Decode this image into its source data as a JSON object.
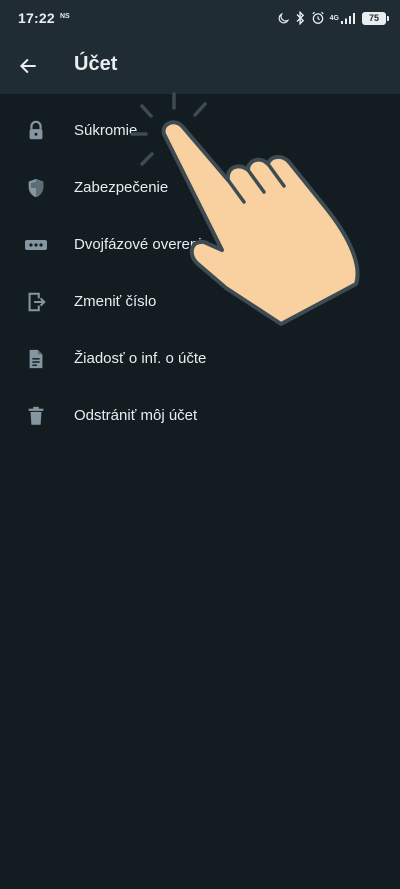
{
  "status_bar": {
    "time": "17:22",
    "ns_label": "NS",
    "network": "4G",
    "battery": "75",
    "icons": [
      "moon-icon",
      "bluetooth-icon",
      "alarm-icon",
      "signal-icon",
      "battery-icon"
    ]
  },
  "app_bar": {
    "back_icon": "arrow-left-icon",
    "title": "Účet"
  },
  "menu": {
    "items": [
      {
        "label": "Súkromie",
        "icon": "lock-icon"
      },
      {
        "label": "Zabezpečenie",
        "icon": "shield-icon"
      },
      {
        "label": "Dvojfázové overenie",
        "icon": "dots-icon"
      },
      {
        "label": "Zmeniť číslo",
        "icon": "phone-exit-icon"
      },
      {
        "label": "Žiadosť o inf. o účte",
        "icon": "document-icon"
      },
      {
        "label": "Odstrániť môj účet",
        "icon": "trash-icon"
      }
    ]
  },
  "colors": {
    "background": "#131c21",
    "app_bar": "#1f2c33",
    "text": "#e9edef",
    "icon": "#8696a0",
    "hand_fill": "#f9d0a0",
    "hand_stroke": "#3d4b53"
  }
}
